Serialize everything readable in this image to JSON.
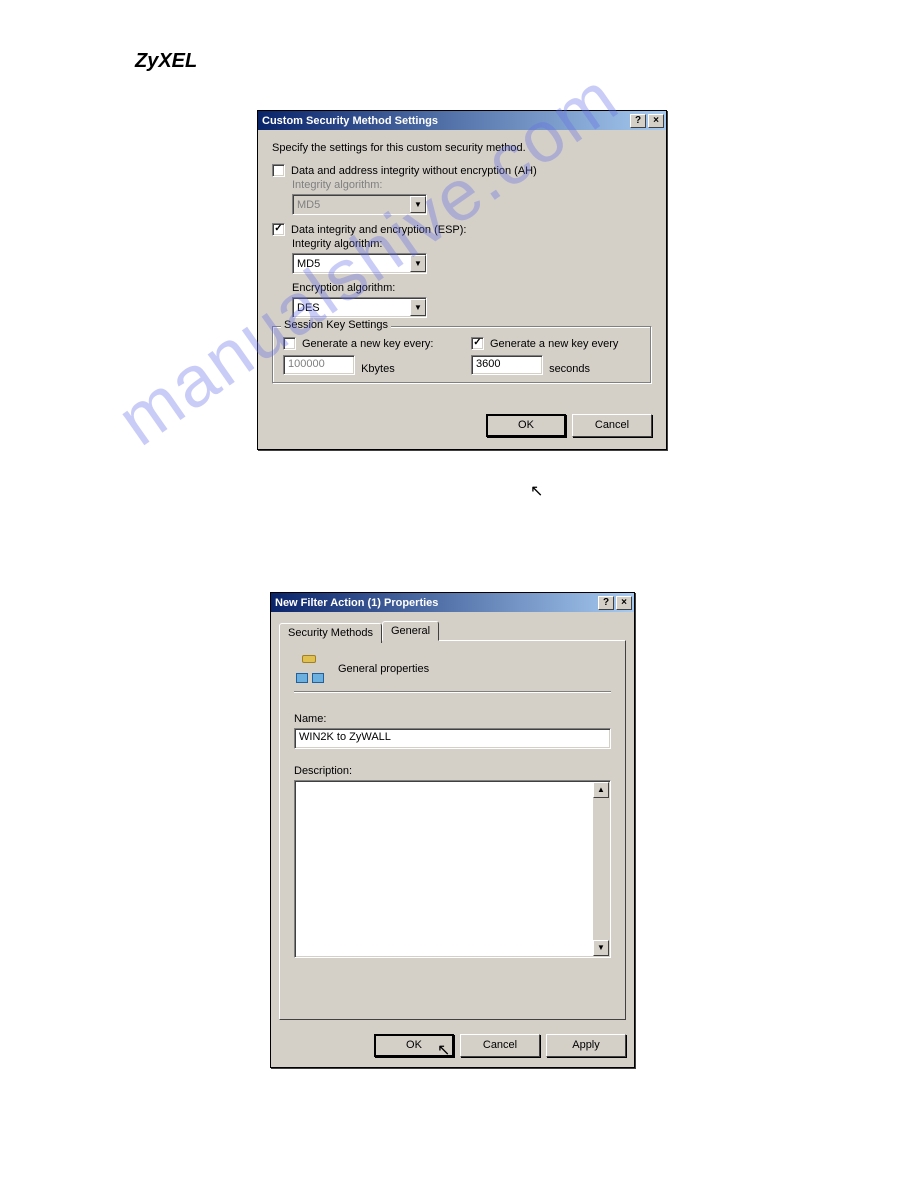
{
  "logo": "ZyXEL",
  "watermark": "manualshive.com",
  "dialog1": {
    "title": "Custom Security Method Settings",
    "instruction": "Specify the settings for this custom security method.",
    "ah": {
      "checkbox_label": "Data and address integrity without encryption (AH)",
      "checked": false,
      "integrity_label": "Integrity algorithm:",
      "integrity_value": "MD5"
    },
    "esp": {
      "checkbox_label": "Data integrity and encryption (ESP):",
      "checked": true,
      "integrity_label": "Integrity algorithm:",
      "integrity_value": "MD5",
      "encryption_label": "Encryption algorithm:",
      "encryption_value": "DES"
    },
    "session": {
      "groupbox_title": "Session Key Settings",
      "kbytes": {
        "checkbox_label": "Generate a new key every:",
        "checked": false,
        "value": "100000",
        "unit": "Kbytes"
      },
      "seconds": {
        "checkbox_label": "Generate a new key every",
        "checked": true,
        "value": "3600",
        "unit": "seconds"
      }
    },
    "buttons": {
      "ok": "OK",
      "cancel": "Cancel"
    }
  },
  "dialog2": {
    "title": "New Filter Action (1) Properties",
    "tabs": {
      "security_methods": "Security Methods",
      "general": "General"
    },
    "general": {
      "heading": "General properties",
      "name_label": "Name:",
      "name_value": "WIN2K to ZyWALL",
      "description_label": "Description:",
      "description_value": ""
    },
    "buttons": {
      "ok": "OK",
      "cancel": "Cancel",
      "apply": "Apply"
    }
  }
}
